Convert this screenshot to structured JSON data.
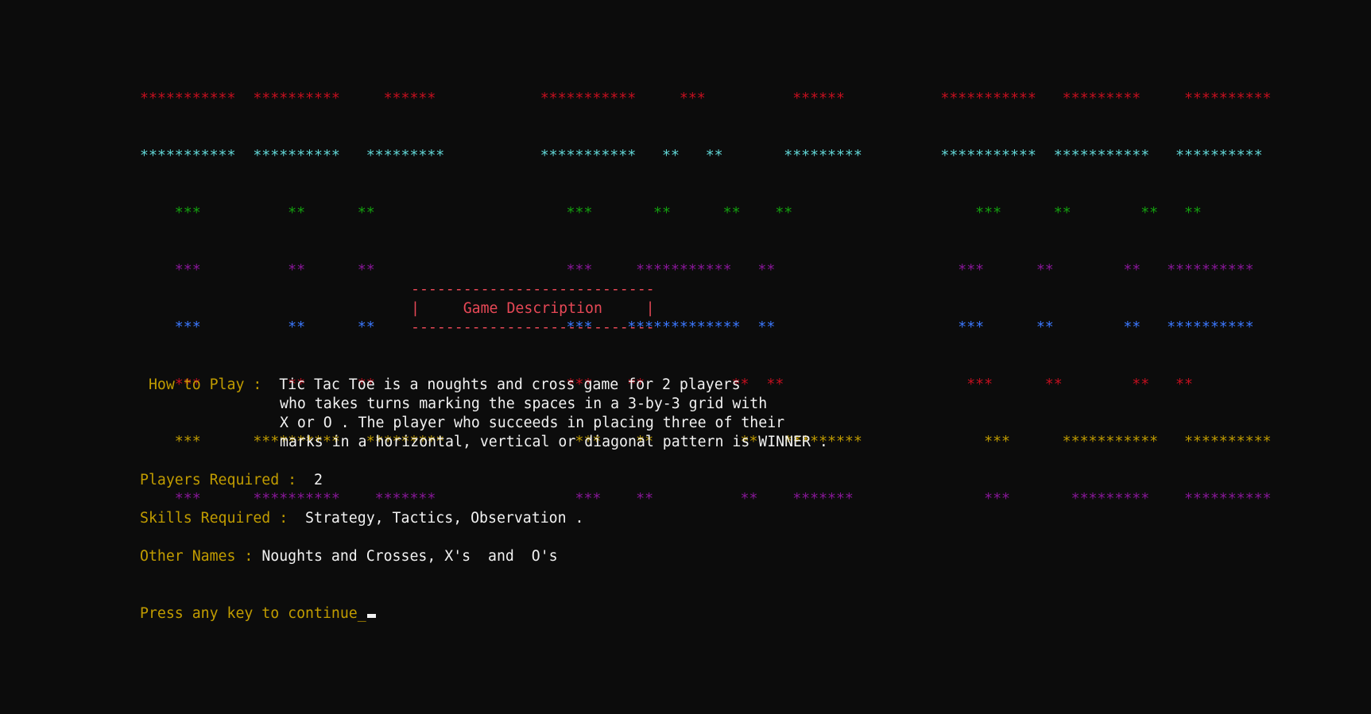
{
  "colors": {
    "background": "#0c0c0c",
    "red": "#c50f1f",
    "cyan": "#61d6d6",
    "green": "#13a10e",
    "magenta": "#881798",
    "blue": "#3b78ff",
    "yellow": "#c19c00",
    "pink": "#e74856",
    "white": "#f2f2f2"
  },
  "banner": {
    "rows": [
      {
        "color": "red",
        "text": "***********  **********     ******            ***********     ***          ******           ***********   *********     **********"
      },
      {
        "color": "cyan",
        "text": "***********  **********   *********           ***********   **   **       *********         ***********  ***********   **********"
      },
      {
        "color": "green",
        "text": "    ***          **      **                      ***       **      **    **                     ***      **        **   **"
      },
      {
        "color": "magenta",
        "text": "    ***          **      **                      ***     ***********   **                     ***      **        **   **********"
      },
      {
        "color": "blue",
        "text": "    ***          **      **                      ***    *************  **                     ***      **        **   **********"
      },
      {
        "color": "red",
        "text": "    ***          **      **                      ***    **          **  **                     ***      **        **   **"
      },
      {
        "color": "yellow",
        "text": "    ***      **********   *********               ***    **          **   *********              ***      ***********   **********"
      },
      {
        "color": "magenta",
        "text": "    ***      **********    *******                ***    **          **    *******               ***       *********    **********"
      }
    ]
  },
  "title_box": {
    "top_border": "----------------------------",
    "title_line": "|     Game Description     |",
    "bottom_border": "----------------------------"
  },
  "description": {
    "how_to_play_label": " How to Play :  ",
    "how_to_play_lines": [
      "Tic Tac Toe is a noughts and cross game for 2 players",
      "who takes turns marking the spaces in a 3-by-3 grid with",
      "X or O . The player who succeeds in placing three of their",
      "marks in a horizontal, vertical or diagonal pattern is WINNER ."
    ],
    "players_label": "Players Required :  ",
    "players_value": "2",
    "skills_label": "Skills Required :  ",
    "skills_value": "Strategy, Tactics, Observation .",
    "other_names_label": "Other Names : ",
    "other_names_value": "Noughts and Crosses, X's  and  O's"
  },
  "prompt": {
    "text": "Press any key to continue_"
  }
}
